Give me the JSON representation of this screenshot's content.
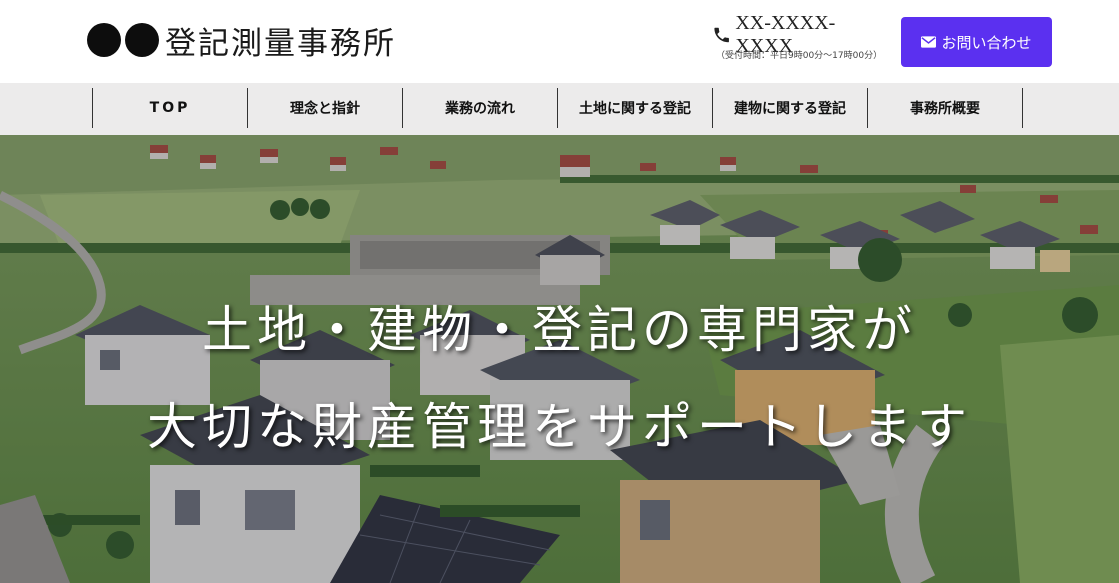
{
  "header": {
    "logo_text": "登記測量事務所",
    "phone": "XX-XXXX-XXXX",
    "hours": "（受付時間：平日9時00分～17時00分）",
    "inquiry_label": "お問い合わせ",
    "colors": {
      "accent": "#5b30f0",
      "logo_dots": "#0d0d0d"
    },
    "icons": {
      "phone": "phone-icon",
      "mail": "mail-icon"
    }
  },
  "nav": {
    "items": [
      {
        "label": "TOP"
      },
      {
        "label": "理念と指針"
      },
      {
        "label": "業務の流れ"
      },
      {
        "label": "土地に関する登記"
      },
      {
        "label": "建物に関する登記"
      },
      {
        "label": "事務所概要"
      }
    ]
  },
  "hero": {
    "line1": "土地・建物・登記の専門家が",
    "line2": "大切な財産管理をサポートします"
  }
}
